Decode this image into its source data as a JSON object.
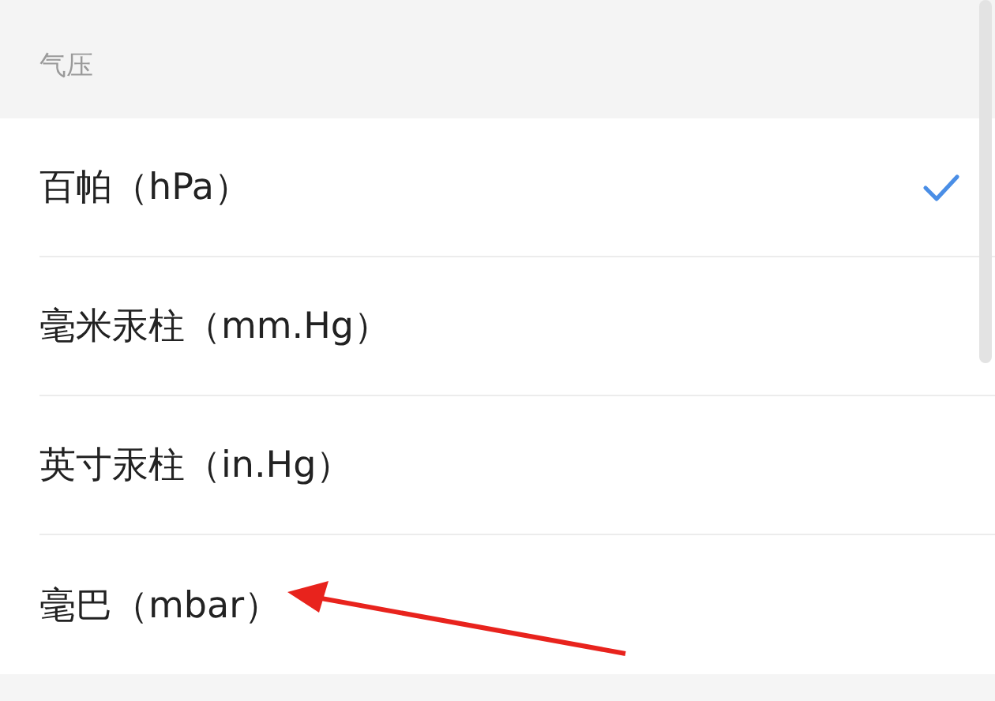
{
  "section": {
    "title": "气压"
  },
  "options": [
    {
      "label": "百帕（hPa）",
      "selected": true
    },
    {
      "label": "毫米汞柱（mm.Hg）",
      "selected": false
    },
    {
      "label": "英寸汞柱（in.Hg）",
      "selected": false
    },
    {
      "label": "毫巴（mbar）",
      "selected": false
    }
  ]
}
